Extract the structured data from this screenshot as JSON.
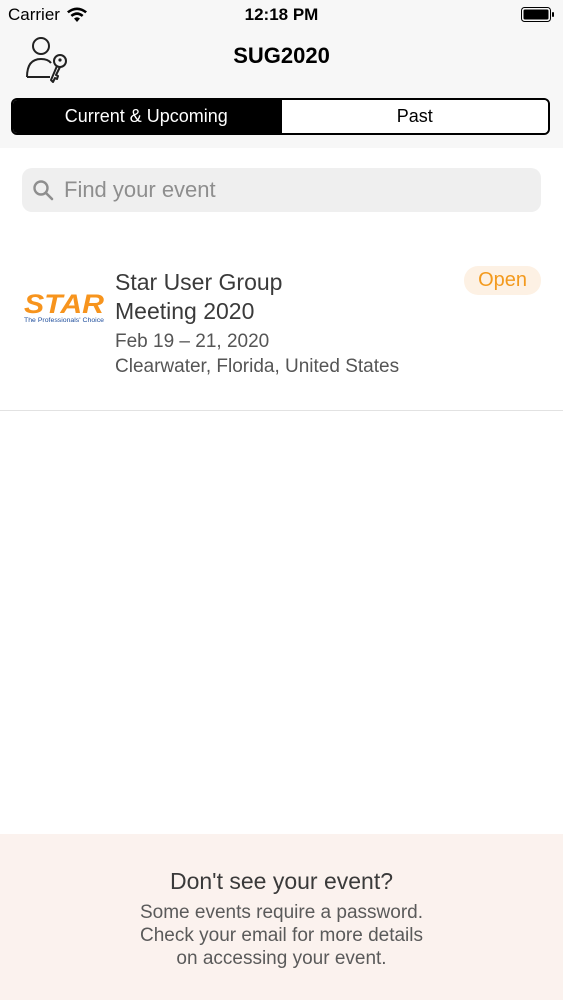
{
  "status_bar": {
    "carrier": "Carrier",
    "time": "12:18 PM"
  },
  "header": {
    "title": "SUG2020",
    "account_icon": "user-key-icon"
  },
  "tabs": [
    {
      "label": "Current & Upcoming",
      "active": true
    },
    {
      "label": "Past",
      "active": false
    }
  ],
  "search": {
    "placeholder": "Find your event",
    "value": ""
  },
  "events": [
    {
      "title_line1": "Star User Group",
      "title_line2": "Meeting 2020",
      "date": "Feb 19 – 21, 2020",
      "location": "Clearwater, Florida, United States",
      "status": "Open",
      "logo_text": "STAR",
      "logo_tagline": "The Professionals' Choice"
    }
  ],
  "footer": {
    "title": "Don't see your event?",
    "line1": "Some events require a password.",
    "line2": "Check your email for more details",
    "line3": "on accessing your event."
  },
  "colors": {
    "accent": "#f39a1e",
    "segment_active_bg": "#000000",
    "header_bg": "#f7f7f7",
    "footer_bg": "#fbf2ee",
    "logo_orange": "#f7941d",
    "logo_blue": "#1f4e9c"
  }
}
